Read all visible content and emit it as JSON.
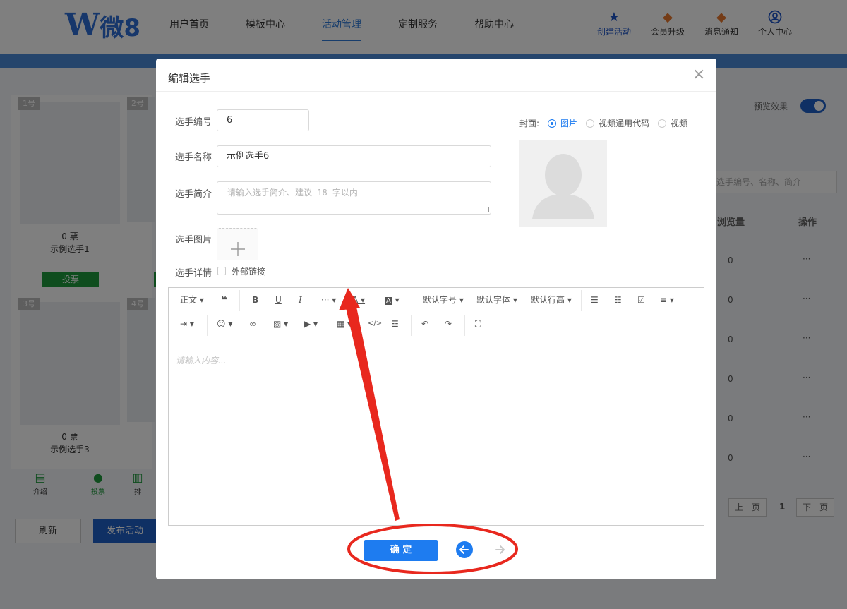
{
  "logo": {
    "letter": "W",
    "text": "微8"
  },
  "nav": [
    {
      "label": "用户首页"
    },
    {
      "label": "模板中心"
    },
    {
      "label": "活动管理",
      "active": true
    },
    {
      "label": "定制服务"
    },
    {
      "label": "帮助中心"
    }
  ],
  "tools": [
    {
      "label": "创建活动",
      "icon": "star-icon"
    },
    {
      "label": "会员升级",
      "icon": "crown-icon"
    },
    {
      "label": "消息通知",
      "icon": "bell-icon"
    },
    {
      "label": "个人中心",
      "icon": "user-icon"
    }
  ],
  "cards": [
    {
      "num": "1号",
      "votes": "0 票",
      "name": "示例选手1",
      "vote_label": "投票"
    },
    {
      "num": "2号"
    },
    {
      "num": "3号",
      "votes": "0 票",
      "name": "示例选手3"
    },
    {
      "num": "4号"
    }
  ],
  "bottom_tabs": [
    {
      "label": "介绍"
    },
    {
      "label": "投票",
      "active": true
    },
    {
      "label": "排"
    }
  ],
  "buttons": {
    "refresh": "刷新",
    "publish": "发布活动"
  },
  "right_panel": {
    "preview_label": "预览效果",
    "search_placeholder": "选手编号、名称、简介",
    "col_views": "浏览量",
    "col_ops": "操作",
    "rows": [
      {
        "views": "0",
        "ops": "···"
      },
      {
        "views": "0",
        "ops": "···"
      },
      {
        "views": "0",
        "ops": "···"
      },
      {
        "views": "0",
        "ops": "···"
      },
      {
        "views": "0",
        "ops": "···"
      },
      {
        "views": "0",
        "ops": "···"
      }
    ],
    "pagination": {
      "prev_label": "上一页",
      "page": "1",
      "next_label": "下一页"
    }
  },
  "modal": {
    "title": "编辑选手",
    "close": "×",
    "fields": {
      "number_label": "选手编号",
      "number_value": "6",
      "name_label": "选手名称",
      "name_value": "示例选手6",
      "intro_label": "选手简介",
      "intro_placeholder": "请输入选手简介、建议 18 字以内",
      "image_label": "选手图片",
      "detail_label": "选手详情",
      "external_link_label": "外部链接"
    },
    "cover": {
      "label": "封面:",
      "options": [
        {
          "label": "图片",
          "selected": true
        },
        {
          "label": "视频通用代码",
          "selected": false
        },
        {
          "label": "视频",
          "selected": false
        }
      ]
    },
    "editor": {
      "toolbar": {
        "paragraph": "正文",
        "font_size": "默认字号",
        "font_family": "默认字体",
        "line_height": "默认行高"
      },
      "placeholder": "请输入内容..."
    },
    "confirm_label": "确 定"
  },
  "colors": {
    "accent": "#1e7cf0",
    "green": "#1e9a3d",
    "annotation": "#e8281e"
  }
}
